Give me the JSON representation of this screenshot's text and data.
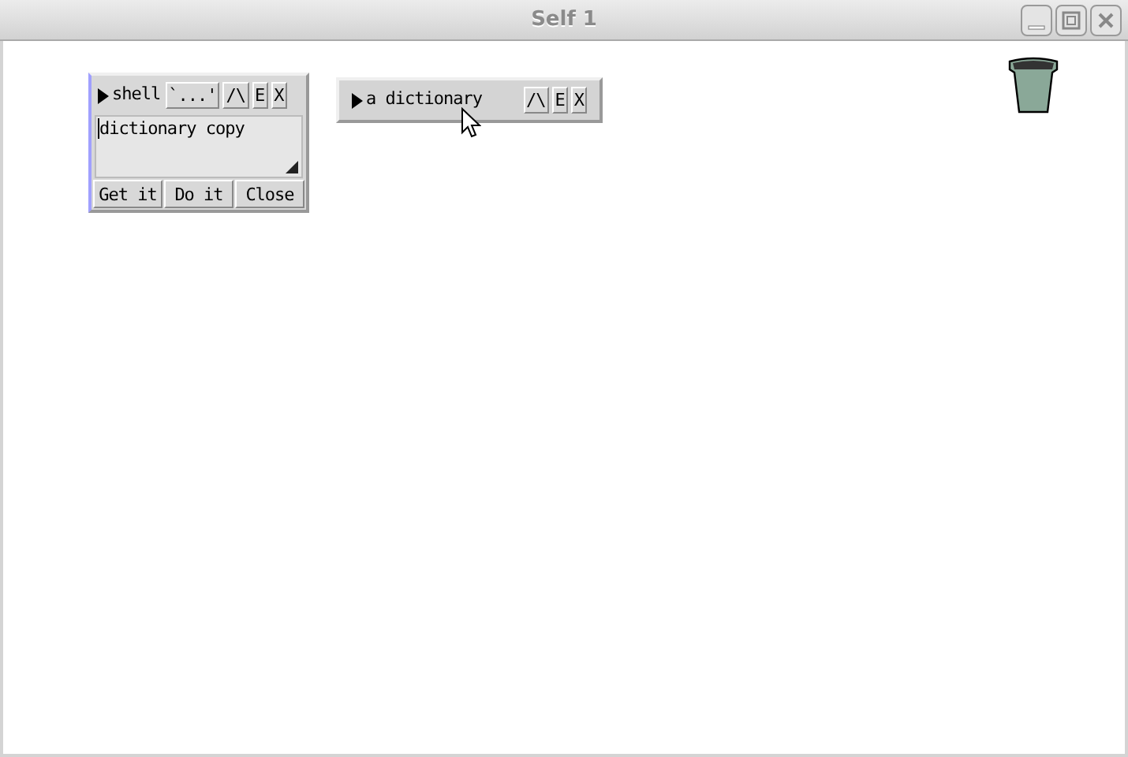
{
  "window": {
    "title": "Self 1"
  },
  "shell": {
    "title": "shell",
    "expanded": false,
    "header_buttons": [
      "`...'",
      "/\\",
      "E",
      "X"
    ],
    "text": "dictionary copy",
    "buttons": [
      "Get it",
      "Do it",
      "Close"
    ]
  },
  "object": {
    "title": "a dictionary",
    "expanded": false,
    "header_buttons": [
      "/\\",
      "E",
      "X"
    ]
  }
}
